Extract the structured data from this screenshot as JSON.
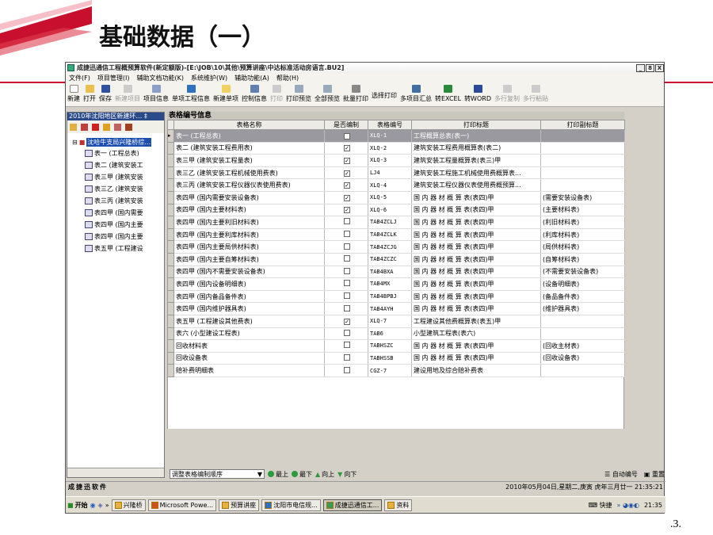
{
  "slide": {
    "title": "基础数据（一）",
    "page_number": ".3."
  },
  "window": {
    "title": "成捷迅通信工程概预算软件(新定额版)-[E:\\JOB\\10\\其他\\预算讲座\\中达标准活动房语言.BU2]",
    "buttons": [
      "_",
      "8",
      "X"
    ]
  },
  "menu": [
    "文件(F)",
    "项目管理(I)",
    "辅助文档功能(K)",
    "系统维护(W)",
    "辅助功能(A)",
    "帮助(H)"
  ],
  "toolbar": {
    "items": [
      {
        "label": "新建",
        "enabled": true
      },
      {
        "label": "打开",
        "enabled": true
      },
      {
        "label": "保存",
        "enabled": true
      },
      {
        "label": "新建项目",
        "enabled": false
      },
      {
        "label": "项目信息",
        "enabled": true
      },
      {
        "label": "单项工程信息",
        "enabled": true
      },
      {
        "label": "新建单项",
        "enabled": true
      },
      {
        "label": "控制信息",
        "enabled": true
      },
      {
        "label": "打印",
        "enabled": false
      },
      {
        "label": "打印预览",
        "enabled": true
      },
      {
        "label": "全部预览",
        "enabled": true
      },
      {
        "label": "批量打印",
        "enabled": true
      },
      {
        "label": "选择打印",
        "enabled": true
      },
      {
        "label": "多项目汇总",
        "enabled": true
      },
      {
        "label": "转EXCEL",
        "enabled": true
      },
      {
        "label": "转WORD",
        "enabled": true
      },
      {
        "label": "多行复制",
        "enabled": false
      },
      {
        "label": "多行粘贴",
        "enabled": false
      }
    ]
  },
  "left_pane": {
    "title": "2010年沈阳地区新建环…",
    "pin": "‡",
    "root": "沈哈牛支局兴隆桥综…",
    "nodes": [
      "表一 (工程总表)",
      "表二 (建筑安装工",
      "表三甲 (建筑安装",
      "表三乙 (建筑安装",
      "表三丙 (建筑安装",
      "表四甲 (国内需要",
      "表四甲 (国内主要",
      "表四甲 (国内主要",
      "表五甲 (工程建设"
    ]
  },
  "grid": {
    "title": "表格编号信息",
    "columns": [
      "表格名称",
      "是否编制",
      "表格编号",
      "打印标题",
      "打印副标题"
    ],
    "rows": [
      {
        "name": "表一 (工程总表)",
        "checked": true,
        "code": "XLQ-1",
        "print_title": "工程概算总表(表一)",
        "subtitle": "",
        "selected": true
      },
      {
        "name": "表二 (建筑安装工程费用表)",
        "checked": true,
        "code": "XLQ-2",
        "print_title": "建筑安装工程费用概算表(表二)",
        "subtitle": ""
      },
      {
        "name": "表三甲 (建筑安装工程量表)",
        "checked": true,
        "code": "XLQ-3",
        "print_title": "建筑安装工程量概算表(表三)甲",
        "subtitle": ""
      },
      {
        "name": "表三乙 (建筑安装工程机械使用费表)",
        "checked": true,
        "code": "LJ4",
        "print_title": "建筑安装工程施工机械使用费概算表...",
        "subtitle": ""
      },
      {
        "name": "表三丙 (建筑安装工程仪器仪表使用费表)",
        "checked": true,
        "code": "XLQ-4",
        "print_title": "建筑安装工程仪器仪表使用费概预算...",
        "subtitle": ""
      },
      {
        "name": "表四甲 (国内需要安装设备表)",
        "checked": true,
        "code": "XLQ-5",
        "print_title": "国 内 器 材 概 算 表(表四)甲",
        "subtitle": "(需要安装设备表)"
      },
      {
        "name": "表四甲 (国内主要材料表)",
        "checked": true,
        "code": "XLQ-6",
        "print_title": "国 内 器 材 概 算 表(表四)甲",
        "subtitle": "(主要材料表)"
      },
      {
        "name": "表四甲 (国内主要利旧材料表)",
        "checked": false,
        "code": "TAB4ZCLJ",
        "print_title": "国 内 器 材 概 算 表(表四)甲",
        "subtitle": "(利旧材料表)"
      },
      {
        "name": "表四甲 (国内主要利库材料表)",
        "checked": false,
        "code": "TAB4ZCLK",
        "print_title": "国 内 器 材 概 算 表(表四)甲",
        "subtitle": "(利库材料表)"
      },
      {
        "name": "表四甲 (国内主要局供材料表)",
        "checked": false,
        "code": "TAB4ZCJG",
        "print_title": "国 内 器 材 概 算 表(表四)甲",
        "subtitle": "(局供材料表)"
      },
      {
        "name": "表四甲 (国内主要自筹材料表)",
        "checked": false,
        "code": "TAB4ZCZC",
        "print_title": "国 内 器 材 概 算 表(表四)甲",
        "subtitle": "(自筹材料表)"
      },
      {
        "name": "表四甲 (国内不需要安装设备表)",
        "checked": false,
        "code": "TAB4BXA",
        "print_title": "国 内 器 材 概 算 表(表四)甲",
        "subtitle": "(不需要安装设备表)"
      },
      {
        "name": "表四甲 (国内设备明细表)",
        "checked": false,
        "code": "TAB4MX",
        "print_title": "国 内 器 材 概 算 表(表四)甲",
        "subtitle": "(设备明细表)"
      },
      {
        "name": "表四甲 (国内备品备件表)",
        "checked": false,
        "code": "TAB4BPBJ",
        "print_title": "国 内 器 材 概 算 表(表四)甲",
        "subtitle": "(备品备件表)"
      },
      {
        "name": "表四甲 (国内维护器具表)",
        "checked": false,
        "code": "TAB4AYH",
        "print_title": "国 内 器 材 概 算 表(表四)甲",
        "subtitle": "(维护器具表)"
      },
      {
        "name": "表五甲 (工程建设其他费表)",
        "checked": true,
        "code": "XLQ-7",
        "print_title": "工程建设其他费概算表(表五)甲",
        "subtitle": ""
      },
      {
        "name": "表六 (小型建设工程表)",
        "checked": false,
        "code": "TAB6",
        "print_title": "小型建筑工程表(表六)",
        "subtitle": ""
      },
      {
        "name": "回收材料表",
        "checked": false,
        "code": "TABHSZC",
        "print_title": "国 内 器 材 概 算 表(表四)甲",
        "subtitle": "(回收主材表)"
      },
      {
        "name": "回收设备表",
        "checked": false,
        "code": "TABHSSB",
        "print_title": "国 内 器 材 概 算 表(表四)甲",
        "subtitle": "(回收设备表)"
      },
      {
        "name": "赔补费明细表",
        "checked": false,
        "code": "CGZ-7",
        "print_title": "建设用地及综合赔补费表",
        "subtitle": ""
      }
    ]
  },
  "bottom_bar": {
    "order_select": "调整表格编制顺序",
    "buttons": [
      "最上",
      "最下",
      "向上",
      "向下"
    ],
    "auto_number": "自动编号",
    "reset": "重置"
  },
  "status": {
    "left": "成捷迅软件",
    "right": "2010年05月04日,星期二,庚寅 虎年三月廿一 21:35:21"
  },
  "taskbar": {
    "start": "开始",
    "tasks": [
      "兴隆桥",
      "Microsoft Powe...",
      "预算讲座",
      "沈阳市电信规...",
      "成捷迅通信工...",
      "资料"
    ],
    "active_index": 4,
    "ime": "快捷",
    "clock": "21:35"
  },
  "colors": {
    "accent_red": "#c8102e",
    "selected_row": "#9a99a0",
    "tree_selected": "#1c4fb0"
  }
}
